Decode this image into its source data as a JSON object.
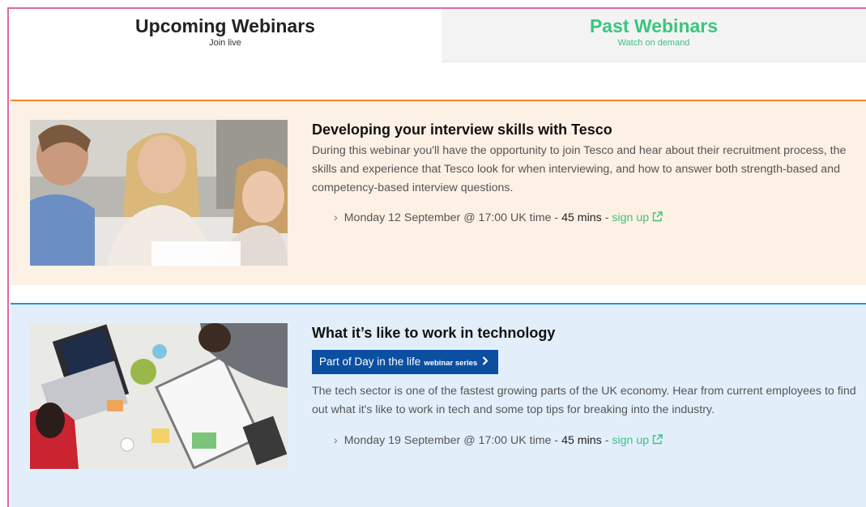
{
  "tabs": {
    "upcoming": {
      "title": "Upcoming Webinars",
      "subtitle": "Join live"
    },
    "past": {
      "title": "Past Webinars",
      "subtitle": "Watch on demand"
    }
  },
  "colors": {
    "accent_green": "#3cc47f",
    "card1_border": "#f08a24",
    "card1_bg": "#fdf0e4",
    "card2_border": "#2b8ee0",
    "card2_bg": "#e2effb",
    "series_button": "#0b4fa0"
  },
  "webinars": [
    {
      "title": "Developing your interview skills with Tesco",
      "description": "During this webinar you'll have the opportunity to join Tesco and hear about their recruitment process, the skills and experience that Tesco look for when interviewing, and how to answer both strength-based and competency-based interview questions.",
      "chevron": "›",
      "date_text": "Monday 12 September @ 17:00 UK time - ",
      "duration": "45 mins",
      "separator": " - ",
      "signup_label": "sign up",
      "image_icon": "photo-people-icon"
    },
    {
      "title": "What it’s like to work in technology",
      "series_label": "Part of Day in the life",
      "series_small": "webinar series",
      "description": "The tech sector is one of the fastest growing parts of the UK economy. Hear from current employees to find out what it's like to work in tech and some top tips for breaking into the industry.",
      "chevron": "›",
      "date_text": "Monday 19 September @ 17:00 UK time - ",
      "duration": "45 mins",
      "separator": " - ",
      "signup_label": "sign up",
      "image_icon": "photo-desk-icon"
    }
  ]
}
